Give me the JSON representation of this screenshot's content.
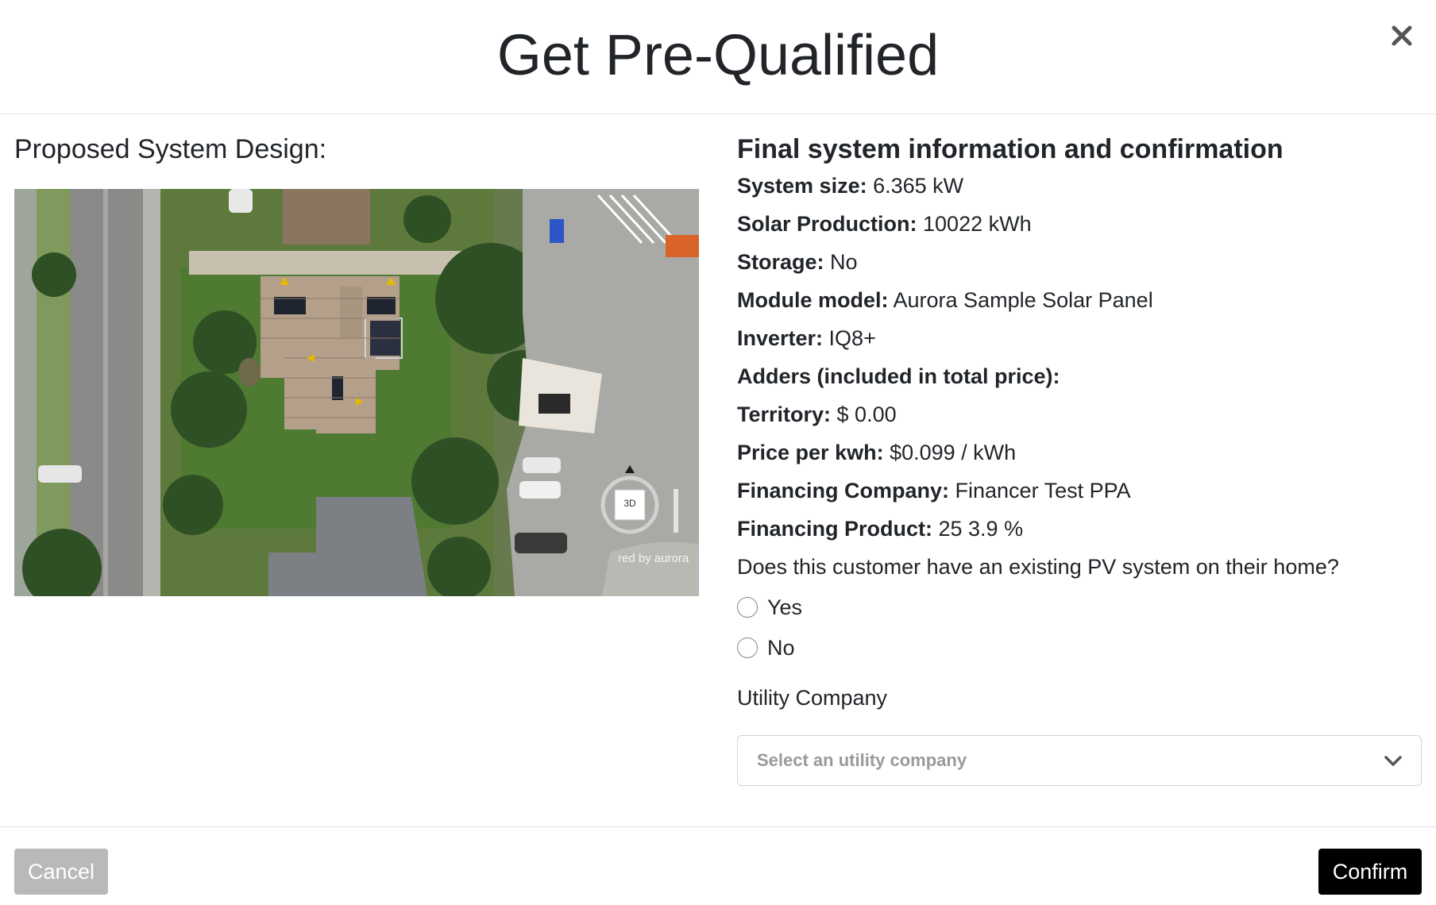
{
  "modal": {
    "title": "Get Pre-Qualified",
    "close_icon": "close-icon"
  },
  "left": {
    "title": "Proposed System Design:",
    "map": {
      "compass_label": "3D",
      "watermark": "red by aurora"
    }
  },
  "right": {
    "title": "Final system information and confirmation",
    "rows": [
      {
        "label": "System size:",
        "value": " 6.365 kW"
      },
      {
        "label": "Solar Production:",
        "value": " 10022 kWh"
      },
      {
        "label": "Storage:",
        "value": " No"
      },
      {
        "label": "Module model:",
        "value": " Aurora Sample Solar Panel"
      },
      {
        "label": "Inverter:",
        "value": " IQ8+"
      },
      {
        "label": "Adders (included in total price):",
        "value": ""
      },
      {
        "label": "Territory:",
        "value": " $ 0.00"
      },
      {
        "label": "Price per kwh:",
        "value": " $0.099 / kWh"
      },
      {
        "label": "Financing Company:",
        "value": " Financer Test PPA"
      },
      {
        "label": "Financing Product:",
        "value": " 25 3.9 %"
      }
    ],
    "question": "Does this customer have an existing PV system on their home?",
    "options": [
      "Yes",
      "No"
    ],
    "utility_label": "Utility Company",
    "utility_placeholder": "Select an utility company"
  },
  "footer": {
    "cancel_label": "Cancel",
    "confirm_label": "Confirm"
  },
  "colors": {
    "confirm_bg": "#000000",
    "cancel_bg": "#b9b9b9",
    "placeholder": "#9a9a9a"
  }
}
